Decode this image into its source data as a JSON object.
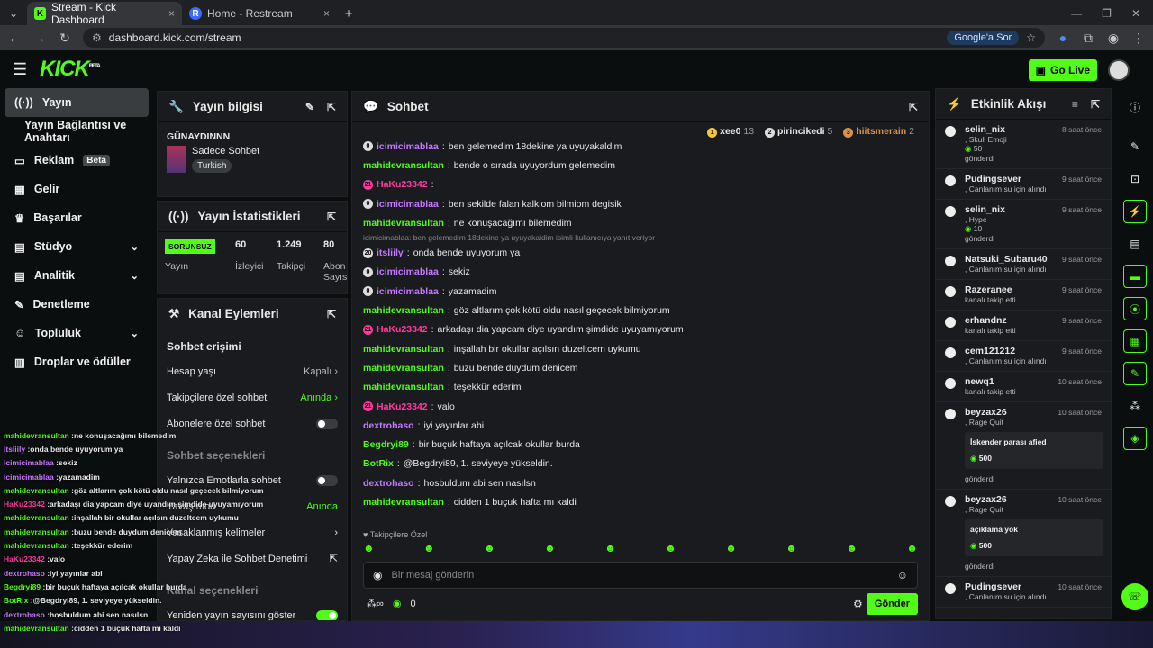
{
  "browser": {
    "tabs": [
      {
        "title": "Stream - Kick Dashboard",
        "close": "×"
      },
      {
        "title": "Home - Restream",
        "close": "×"
      }
    ],
    "new_tab": "+",
    "url": "dashboard.kick.com/stream",
    "google_pill": "Google'a Sor"
  },
  "header": {
    "logo": "KICK",
    "logo_sup": "BETA",
    "golive": "Go Live"
  },
  "sidebar": {
    "items": [
      {
        "label": "Yayın",
        "icon": "broadcast-icon"
      },
      {
        "label": "Yayın Bağlantısı ve Anahtarı"
      },
      {
        "label": "Reklam",
        "icon": "ad-icon",
        "badge": "Beta"
      },
      {
        "label": "Gelir",
        "icon": "revenue-icon"
      },
      {
        "label": "Başarılar",
        "icon": "trophy-icon"
      },
      {
        "label": "Stüdyo",
        "icon": "studio-icon",
        "chev": "⌄"
      },
      {
        "label": "Analitik",
        "icon": "analytics-icon",
        "chev": "⌄"
      },
      {
        "label": "Denetleme",
        "icon": "wrench-icon"
      },
      {
        "label": "Topluluk",
        "icon": "community-icon",
        "chev": "⌄"
      },
      {
        "label": "Droplar ve ödüller",
        "icon": "drop-icon"
      }
    ]
  },
  "stream_info": {
    "title": "Yayın bilgisi",
    "stream_title": "GÜNAYDINNN",
    "category": "Sadece Sohbet",
    "tag": "Turkish"
  },
  "stats": {
    "title": "Yayın İstatistikleri",
    "status": "SORUNSUZ",
    "status_label": "Yayın",
    "items": [
      {
        "value": "60",
        "label": "İzleyici"
      },
      {
        "value": "1.249",
        "label": "Takipçi"
      },
      {
        "value": "80",
        "label": "Abon Sayısı"
      }
    ]
  },
  "channel_actions": {
    "title": "Kanal Eylemleri",
    "section1": "Sohbet erişimi",
    "rows": [
      {
        "label": "Hesap yaşı",
        "value": "Kapalı"
      },
      {
        "label": "Takipçilere özel sohbet",
        "value": "Anında"
      },
      {
        "label": "Abonelere özel sohbet",
        "value": ""
      }
    ],
    "section2": "Sohbet seçenekleri",
    "rows2": [
      {
        "label": "Yalnızca Emotlarla sohbet"
      },
      {
        "label": "Yavaş mod",
        "value": "Anında"
      },
      {
        "label": "Yasaklanmış kelimeler"
      },
      {
        "label": "Yapay Zeka ile Sohbet Denetimi"
      }
    ],
    "section3": "Kanal seçenekleri",
    "row3": "Yeniden yayın sayısını göster"
  },
  "chat": {
    "title": "Sohbet",
    "leaders": [
      {
        "rank": "1",
        "name": "xee0",
        "count": "13"
      },
      {
        "rank": "2",
        "name": "pirincikedi",
        "count": "5"
      },
      {
        "rank": "3",
        "name": "hiitsmerain",
        "count": "2"
      }
    ],
    "reply_note": "icimicimablaa: ben gelemedim 18dekine ya uyuyakaldim isimli kullanıcıya yanıt veriyor",
    "messages": [
      {
        "user": "icimicimablaa",
        "text": "ben gelemedim 18dekine ya uyuyakaldim",
        "color": "#c678ff",
        "badge": "0"
      },
      {
        "user": "mahidevransultan",
        "text": "bende o sırada uyuyordum gelemedim",
        "color": "#53fc18"
      },
      {
        "user": "HaKu23342",
        "text": "",
        "color": "#ff3a9b",
        "badge": "21"
      },
      {
        "user": "icimicimablaa",
        "text": "ben sekilde falan kalkiom bilmiom degisik",
        "color": "#c678ff",
        "badge": "0"
      },
      {
        "user": "mahidevransultan",
        "text": "ne konuşacağımı bilemedim",
        "color": "#53fc18"
      },
      {
        "user": "itsliily",
        "text": "onda bende uyuyorum ya",
        "color": "#c678ff",
        "badge": "20"
      },
      {
        "user": "icimicimablaa",
        "text": "sekiz",
        "color": "#c678ff",
        "badge": "0"
      },
      {
        "user": "icimicimablaa",
        "text": "yazamadim",
        "color": "#c678ff",
        "badge": "0"
      },
      {
        "user": "mahidevransultan",
        "text": "göz altlarım çok kötü oldu nasıl geçecek bilmiyorum",
        "color": "#53fc18"
      },
      {
        "user": "HaKu23342",
        "text": "arkadaşı dia yapcam diye uyandım şimdide uyuyamıyorum",
        "color": "#ff3a9b",
        "badge": "21"
      },
      {
        "user": "mahidevransultan",
        "text": "inşallah bir okullar açılsın duzeltcem uykumu",
        "color": "#53fc18"
      },
      {
        "user": "mahidevransultan",
        "text": "buzu bende duydum denicem",
        "color": "#53fc18"
      },
      {
        "user": "mahidevransultan",
        "text": "teşekkür ederim",
        "color": "#53fc18"
      },
      {
        "user": "HaKu23342",
        "text": "valo",
        "color": "#ff3a9b",
        "badge": "21"
      },
      {
        "user": "dextrohaso",
        "text": "iyi yayınlar abi",
        "color": "#c678ff"
      },
      {
        "user": "Begdryi89",
        "text": "bir buçuk haftaya açılcak okullar burda",
        "color": "#53fc18"
      },
      {
        "user": "BotRix",
        "text": "@Begdryi89, 1. seviyeye yükseldin.",
        "color": "#53fc18"
      },
      {
        "user": "dextrohaso",
        "text": "hosbuldum abi sen nasılsn",
        "color": "#c678ff"
      },
      {
        "user": "mahidevransultan",
        "text": "cidden 1 buçuk hafta mı kaldi",
        "color": "#53fc18"
      }
    ],
    "followers_only": "Takipçilere Özel",
    "placeholder": "Bir mesaj gönderin",
    "points": "0",
    "send": "Gönder"
  },
  "feed": {
    "title": "Etkinlik Akışı",
    "items": [
      {
        "name": "selin_nix",
        "time": "8 saat önce",
        "line1": "Skull Emoji",
        "line2": "50",
        "line3": "gönderdi"
      },
      {
        "name": "Pudingsever",
        "time": "9 saat önce",
        "line1": "Canlanım su için",
        "line2": "alındı"
      },
      {
        "name": "selin_nix",
        "time": "9 saat önce",
        "line1": "Hype",
        "line2": "10",
        "line3": "gönderdi"
      },
      {
        "name": "Natsuki_Subaru40",
        "time": "9 saat önce",
        "line1": "Canlanım su için",
        "line2": "alındı"
      },
      {
        "name": "Razeranee",
        "time": "9 saat önce",
        "line1": "kanalı takip etti"
      },
      {
        "name": "erhandnz",
        "time": "9 saat önce",
        "line1": "kanalı takip etti"
      },
      {
        "name": "cem121212",
        "time": "9 saat önce",
        "line1": "Canlanım su için",
        "line2": "alındı"
      },
      {
        "name": "newq1",
        "time": "10 saat önce",
        "line1": "kanalı takip etti"
      },
      {
        "name": "beyzax26",
        "time": "10 saat önce",
        "line1": "Rage Quit",
        "box": "İskender parası afied",
        "amount": "500",
        "line3": "gönderdi"
      },
      {
        "name": "beyzax26",
        "time": "10 saat önce",
        "line1": "Rage Quit",
        "box": "açıklama yok",
        "amount": "500",
        "line3": "gönderdi"
      },
      {
        "name": "Pudingsever",
        "time": "10 saat önce",
        "line1": "Canlanım su için",
        "line2": "alındı"
      }
    ]
  },
  "overlay": [
    {
      "user": "mahidevransultan",
      "text": "ne konuşacağımı bilemedim",
      "color": "#53fc18"
    },
    {
      "user": "itsliily",
      "text": "onda bende uyuyorum ya",
      "color": "#c678ff"
    },
    {
      "user": "icimicimablaa",
      "text": "sekiz",
      "color": "#c678ff"
    },
    {
      "user": "icimicimablaa",
      "text": "yazamadim",
      "color": "#c678ff"
    },
    {
      "user": "mahidevransultan",
      "text": "göz altlarım çok kötü oldu nasıl geçecek bilmiyorum",
      "color": "#53fc18"
    },
    {
      "user": "HaKu23342",
      "text": "arkadaşı dia yapcam diye uyandım şimdide uyuyamıyorum",
      "color": "#ff3a9b"
    },
    {
      "user": "mahidevransultan",
      "text": "inşallah bir okullar açılsın duzeltcem uykumu",
      "color": "#53fc18"
    },
    {
      "user": "mahidevransultan",
      "text": "buzu bende duydum denicem",
      "color": "#53fc18"
    },
    {
      "user": "mahidevransultan",
      "text": "teşekkür ederim",
      "color": "#53fc18"
    },
    {
      "user": "HaKu23342",
      "text": "valo",
      "color": "#ff3a9b"
    },
    {
      "user": "dextrohaso",
      "text": "iyi yayınlar abi",
      "color": "#c678ff"
    },
    {
      "user": "Begdryi89",
      "text": "bir buçuk haftaya açılcak okullar burda",
      "color": "#53fc18"
    },
    {
      "user": "BotRix",
      "text": "@Begdryi89, 1. seviyeye yükseldin.",
      "color": "#53fc18"
    },
    {
      "user": "dextrohaso",
      "text": "hosbuldum abi sen nasılsn",
      "color": "#c678ff"
    },
    {
      "user": "mahidevransultan",
      "text": "cidden 1 buçuk hafta mı kaldi",
      "color": "#53fc18"
    }
  ]
}
